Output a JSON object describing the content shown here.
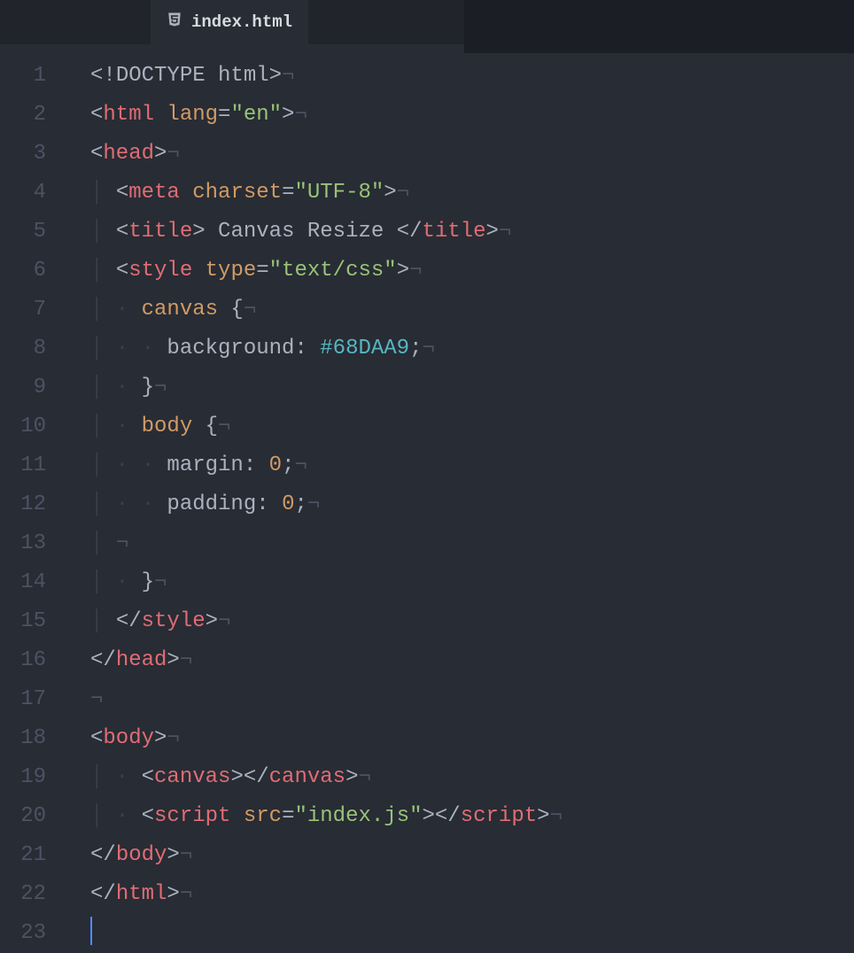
{
  "tab": {
    "filename": "index.html",
    "icon": "html5-icon"
  },
  "lineNumbers": [
    "1",
    "2",
    "3",
    "4",
    "5",
    "6",
    "7",
    "8",
    "9",
    "10",
    "11",
    "12",
    "13",
    "14",
    "15",
    "16",
    "17",
    "18",
    "19",
    "20",
    "21",
    "22",
    "23"
  ],
  "code": {
    "l1": {
      "raw": "<!DOCTYPE html>",
      "tokens": [
        {
          "t": "<!",
          "c": "punct"
        },
        {
          "t": "DOCTYPE html",
          "c": "doctype"
        },
        {
          "t": ">",
          "c": "punct"
        }
      ]
    },
    "l2": {
      "tokens": [
        {
          "t": "<",
          "c": "punct"
        },
        {
          "t": "html",
          "c": "tagname"
        },
        {
          "t": " ",
          "c": "text"
        },
        {
          "t": "lang",
          "c": "attr"
        },
        {
          "t": "=",
          "c": "punct"
        },
        {
          "t": "\"en\"",
          "c": "str"
        },
        {
          "t": ">",
          "c": "punct"
        }
      ]
    },
    "l3": {
      "tokens": [
        {
          "t": "<",
          "c": "punct"
        },
        {
          "t": "head",
          "c": "tagname"
        },
        {
          "t": ">",
          "c": "punct"
        }
      ]
    },
    "l4": {
      "indent": "· ",
      "tokens": [
        {
          "t": "<",
          "c": "punct"
        },
        {
          "t": "meta",
          "c": "tagname"
        },
        {
          "t": " ",
          "c": "text"
        },
        {
          "t": "charset",
          "c": "attr"
        },
        {
          "t": "=",
          "c": "punct"
        },
        {
          "t": "\"UTF-8\"",
          "c": "str"
        },
        {
          "t": ">",
          "c": "punct"
        }
      ]
    },
    "l5": {
      "indent": "· ",
      "tokens": [
        {
          "t": "<",
          "c": "punct"
        },
        {
          "t": "title",
          "c": "tagname"
        },
        {
          "t": ">",
          "c": "punct"
        },
        {
          "t": " Canvas Resize ",
          "c": "text"
        },
        {
          "t": "</",
          "c": "punct"
        },
        {
          "t": "title",
          "c": "tagname"
        },
        {
          "t": ">",
          "c": "punct"
        }
      ]
    },
    "l6": {
      "indent": "· ",
      "tokens": [
        {
          "t": "<",
          "c": "punct"
        },
        {
          "t": "style",
          "c": "tagname"
        },
        {
          "t": " ",
          "c": "text"
        },
        {
          "t": "type",
          "c": "attr"
        },
        {
          "t": "=",
          "c": "punct"
        },
        {
          "t": "\"text/css\"",
          "c": "str"
        },
        {
          "t": ">",
          "c": "punct"
        }
      ]
    },
    "l7": {
      "indent": "· · ",
      "tokens": [
        {
          "t": "canvas",
          "c": "sel"
        },
        {
          "t": " {",
          "c": "punct"
        }
      ]
    },
    "l8": {
      "indent": "· · · ",
      "tokens": [
        {
          "t": "background",
          "c": "prop"
        },
        {
          "t": ": ",
          "c": "punct"
        },
        {
          "t": "#68DAA9",
          "c": "hex"
        },
        {
          "t": ";",
          "c": "punct"
        }
      ]
    },
    "l9": {
      "indent": "· · ",
      "tokens": [
        {
          "t": "}",
          "c": "punct"
        }
      ]
    },
    "l10": {
      "indent": "· · ",
      "tokens": [
        {
          "t": "body",
          "c": "sel"
        },
        {
          "t": " {",
          "c": "punct"
        }
      ]
    },
    "l11": {
      "indent": "· · · ",
      "tokens": [
        {
          "t": "margin",
          "c": "prop"
        },
        {
          "t": ": ",
          "c": "punct"
        },
        {
          "t": "0",
          "c": "num"
        },
        {
          "t": ";",
          "c": "punct"
        }
      ]
    },
    "l12": {
      "indent": "· · · ",
      "tokens": [
        {
          "t": "padding",
          "c": "prop"
        },
        {
          "t": ": ",
          "c": "punct"
        },
        {
          "t": "0",
          "c": "num"
        },
        {
          "t": ";",
          "c": "punct"
        }
      ]
    },
    "l13": {
      "indent": "· ",
      "tokens": []
    },
    "l14": {
      "indent": "· · ",
      "tokens": [
        {
          "t": "}",
          "c": "punct"
        }
      ]
    },
    "l15": {
      "indent": "· ",
      "tokens": [
        {
          "t": "</",
          "c": "punct"
        },
        {
          "t": "style",
          "c": "tagname"
        },
        {
          "t": ">",
          "c": "punct"
        }
      ]
    },
    "l16": {
      "tokens": [
        {
          "t": "</",
          "c": "punct"
        },
        {
          "t": "head",
          "c": "tagname"
        },
        {
          "t": ">",
          "c": "punct"
        }
      ]
    },
    "l17": {
      "indent": "",
      "tokens": []
    },
    "l18": {
      "tokens": [
        {
          "t": "<",
          "c": "punct"
        },
        {
          "t": "body",
          "c": "tagname"
        },
        {
          "t": ">",
          "c": "punct"
        }
      ]
    },
    "l19": {
      "indent": "· · ",
      "tokens": [
        {
          "t": "<",
          "c": "punct"
        },
        {
          "t": "canvas",
          "c": "tagname"
        },
        {
          "t": "></",
          "c": "punct"
        },
        {
          "t": "canvas",
          "c": "tagname"
        },
        {
          "t": ">",
          "c": "punct"
        }
      ]
    },
    "l20": {
      "indent": "· · ",
      "tokens": [
        {
          "t": "<",
          "c": "punct"
        },
        {
          "t": "script",
          "c": "tagname"
        },
        {
          "t": " ",
          "c": "text"
        },
        {
          "t": "src",
          "c": "attr"
        },
        {
          "t": "=",
          "c": "punct"
        },
        {
          "t": "\"index.js\"",
          "c": "str"
        },
        {
          "t": "></",
          "c": "punct"
        },
        {
          "t": "script",
          "c": "tagname"
        },
        {
          "t": ">",
          "c": "punct"
        }
      ]
    },
    "l21": {
      "tokens": [
        {
          "t": "</",
          "c": "punct"
        },
        {
          "t": "body",
          "c": "tagname"
        },
        {
          "t": ">",
          "c": "punct"
        }
      ]
    },
    "l22": {
      "tokens": [
        {
          "t": "</",
          "c": "punct"
        },
        {
          "t": "html",
          "c": "tagname"
        },
        {
          "t": ">",
          "c": "punct"
        }
      ]
    },
    "l23": {
      "cursor": true,
      "tokens": []
    }
  },
  "eolChar": "¬",
  "indentDot": "·",
  "colors": {
    "background": "#282c34",
    "tagname": "#e06c75",
    "attr": "#d19a66",
    "string": "#98c379",
    "hex": "#56b6c2",
    "text": "#abb2bf",
    "gutter": "#4b5363",
    "cursor": "#528bff"
  }
}
